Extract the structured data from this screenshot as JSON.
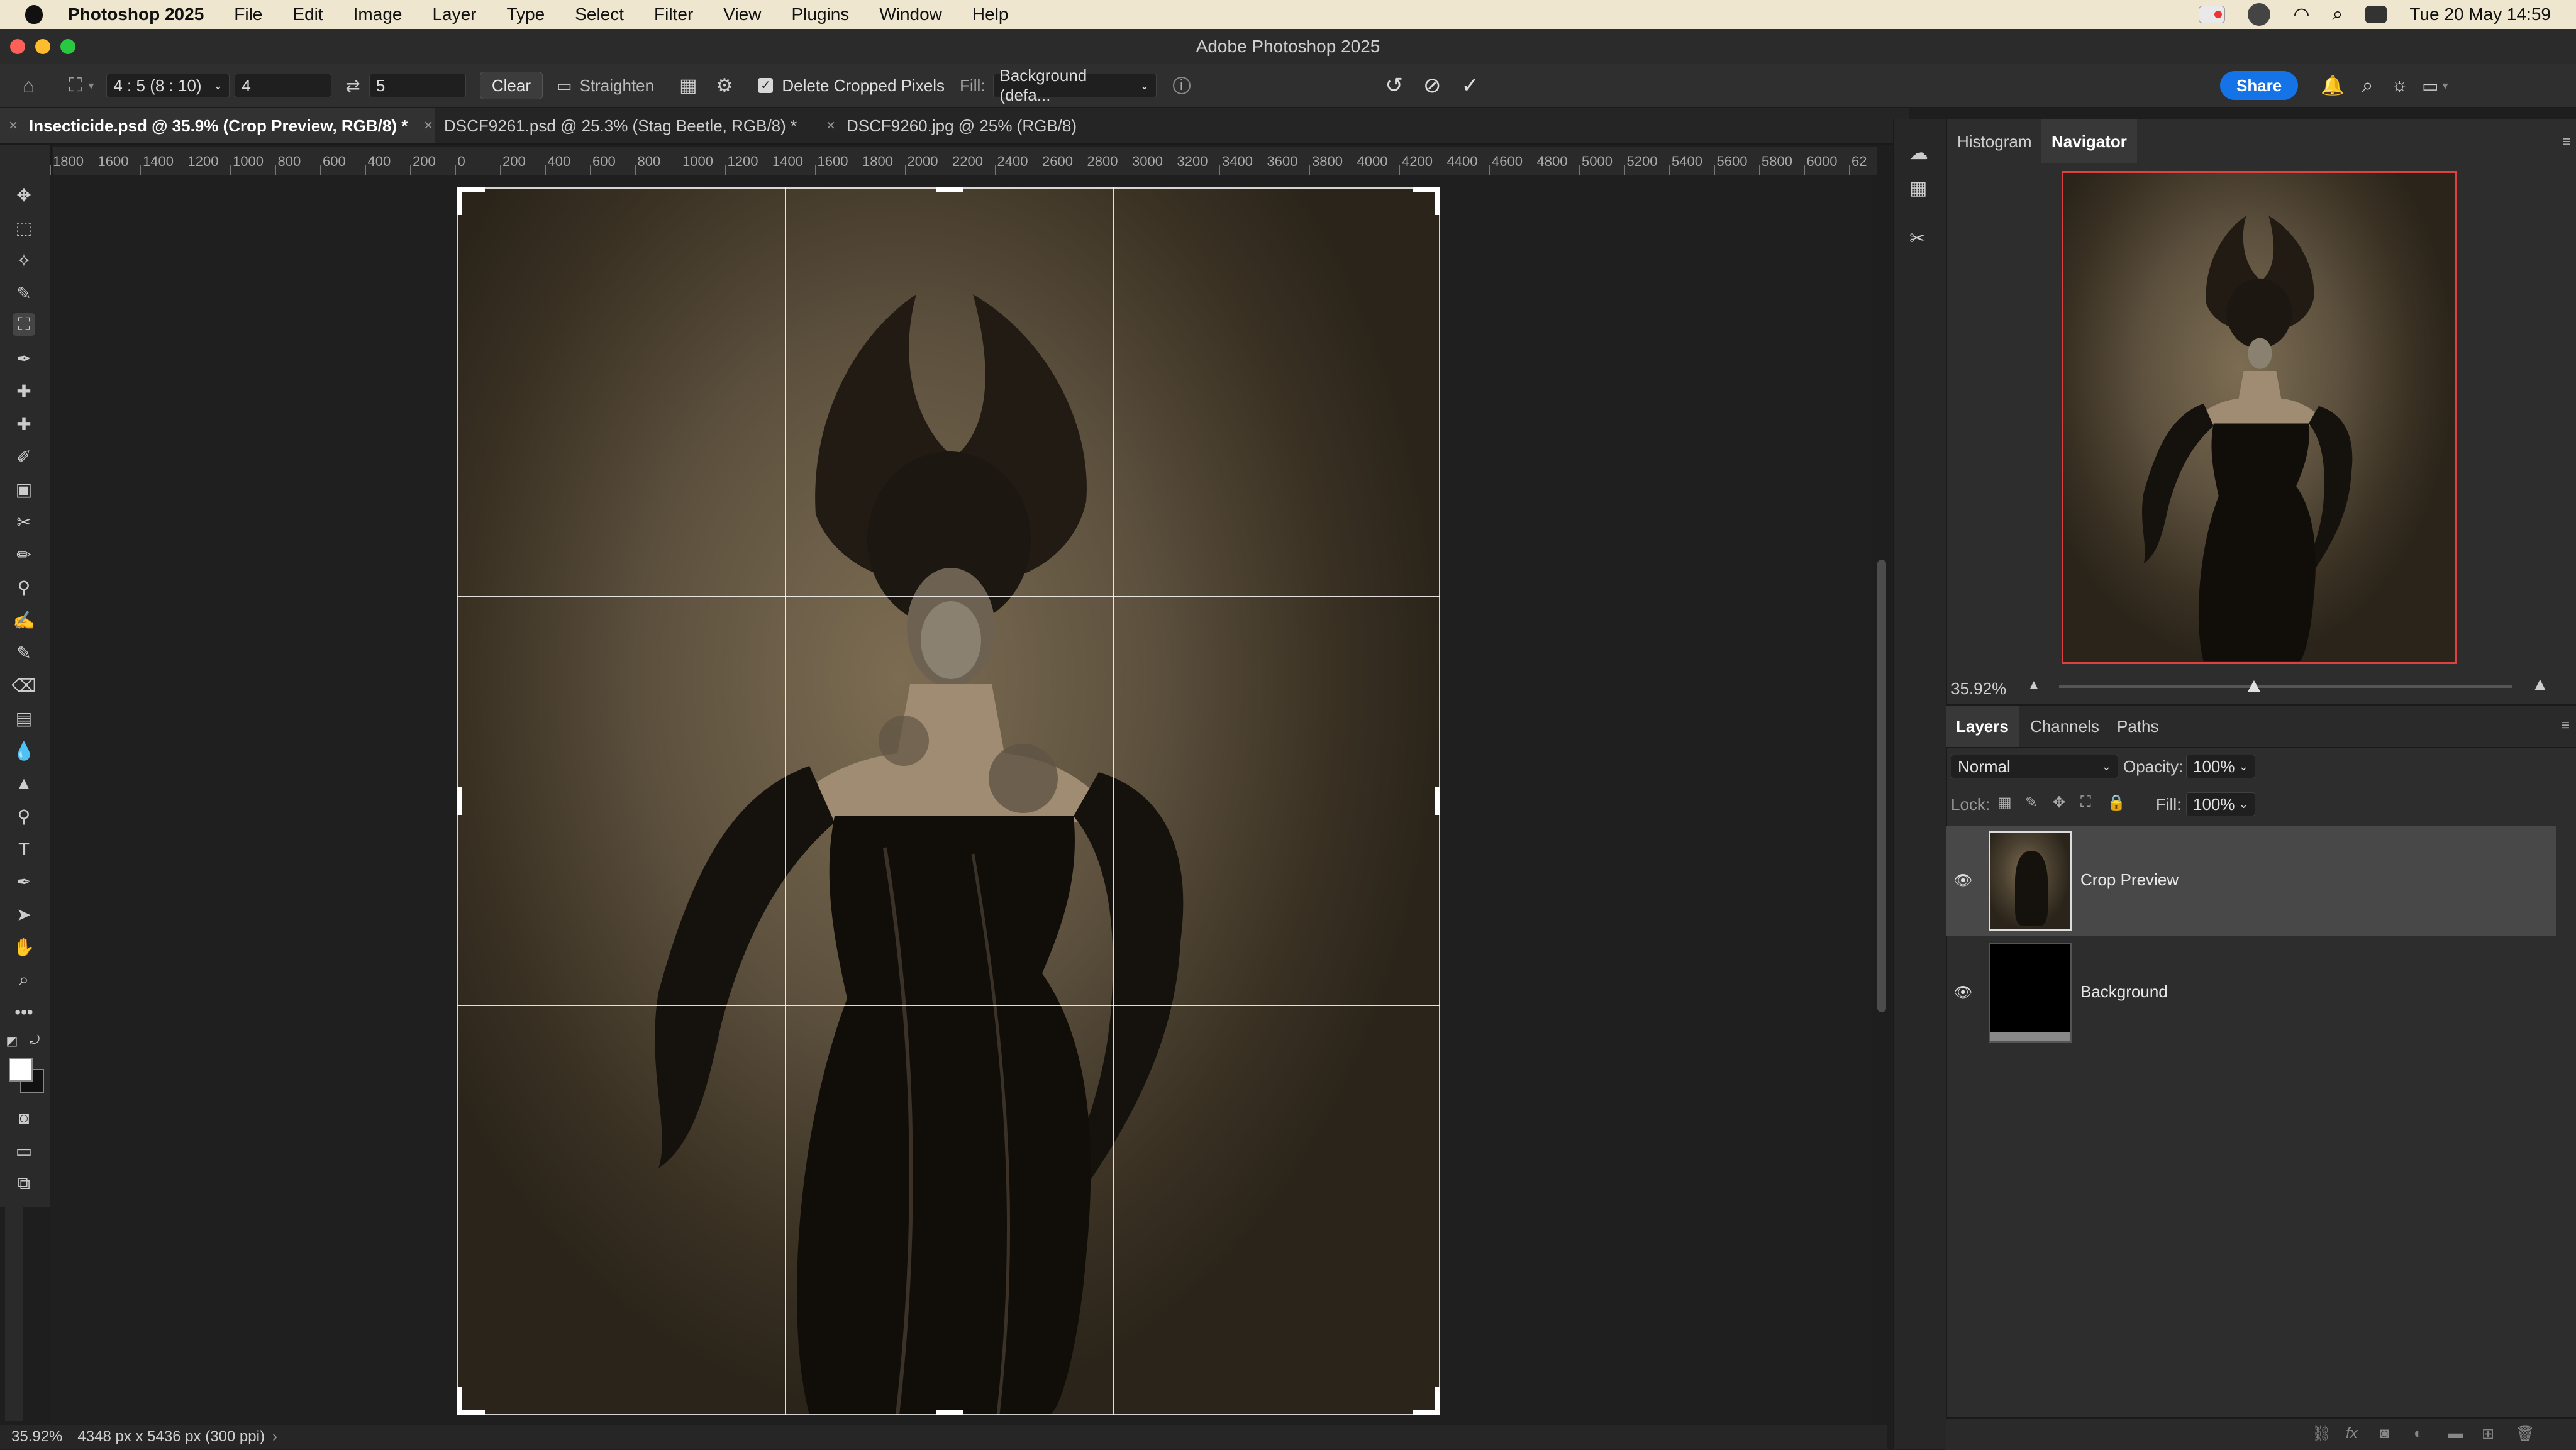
{
  "menubar": {
    "app_name": "Photoshop 2025",
    "items": [
      "File",
      "Edit",
      "Image",
      "Layer",
      "Type",
      "Select",
      "Filter",
      "View",
      "Plugins",
      "Window",
      "Help"
    ],
    "datetime": "Tue 20 May  14:59"
  },
  "window": {
    "title": "Adobe Photoshop 2025"
  },
  "options": {
    "ratio_preset": "4 : 5 (8 : 10)",
    "ratio_width": "4",
    "ratio_height": "5",
    "clear_label": "Clear",
    "straighten_label": "Straighten",
    "delete_cropped_label": "Delete Cropped Pixels",
    "fill_label": "Fill:",
    "fill_value": "Background (defa...",
    "share_label": "Share"
  },
  "tabs": [
    {
      "label": "Insecticide.psd @ 35.9% (Crop Preview, RGB/8) *"
    },
    {
      "label": "DSCF9261.psd @ 25.3% (Stag Beetle, RGB/8) *"
    },
    {
      "label": "DSCF9260.jpg @ 25% (RGB/8)"
    }
  ],
  "ruler": {
    "labels": [
      "1800",
      "1600",
      "1400",
      "1200",
      "1000",
      "800",
      "600",
      "400",
      "200",
      "0",
      "200",
      "400",
      "600",
      "800",
      "1000",
      "1200",
      "1400",
      "1600",
      "1800",
      "2000",
      "2200",
      "2400",
      "2600",
      "2800",
      "3000",
      "3200",
      "3400",
      "3600",
      "3800",
      "4000",
      "4200",
      "4400",
      "4600",
      "4800",
      "5000",
      "5200",
      "5400",
      "5600",
      "5800",
      "6000",
      "62"
    ]
  },
  "status": {
    "zoom": "35.92%",
    "doc_info": "4348 px x 5436 px (300 ppi)"
  },
  "navigator_panel": {
    "tabs": [
      "Histogram",
      "Navigator"
    ],
    "active_tab": "Navigator",
    "zoom": "35.92%",
    "zoom_slider": 0.43
  },
  "layers_panel": {
    "tabs": [
      "Layers",
      "Channels",
      "Paths"
    ],
    "active_tab": "Layers",
    "blend_mode": "Normal",
    "opacity_label": "Opacity:",
    "opacity": "100%",
    "lock_label": "Lock:",
    "fill_label": "Fill:",
    "fill": "100%",
    "layers": [
      {
        "name": "Crop Preview",
        "selected": true
      },
      {
        "name": "Background",
        "selected": false
      }
    ]
  },
  "colors": {
    "accent": "#1473e6",
    "navigator_frame": "#e04040",
    "menubar_bg": "#efe6cf"
  }
}
